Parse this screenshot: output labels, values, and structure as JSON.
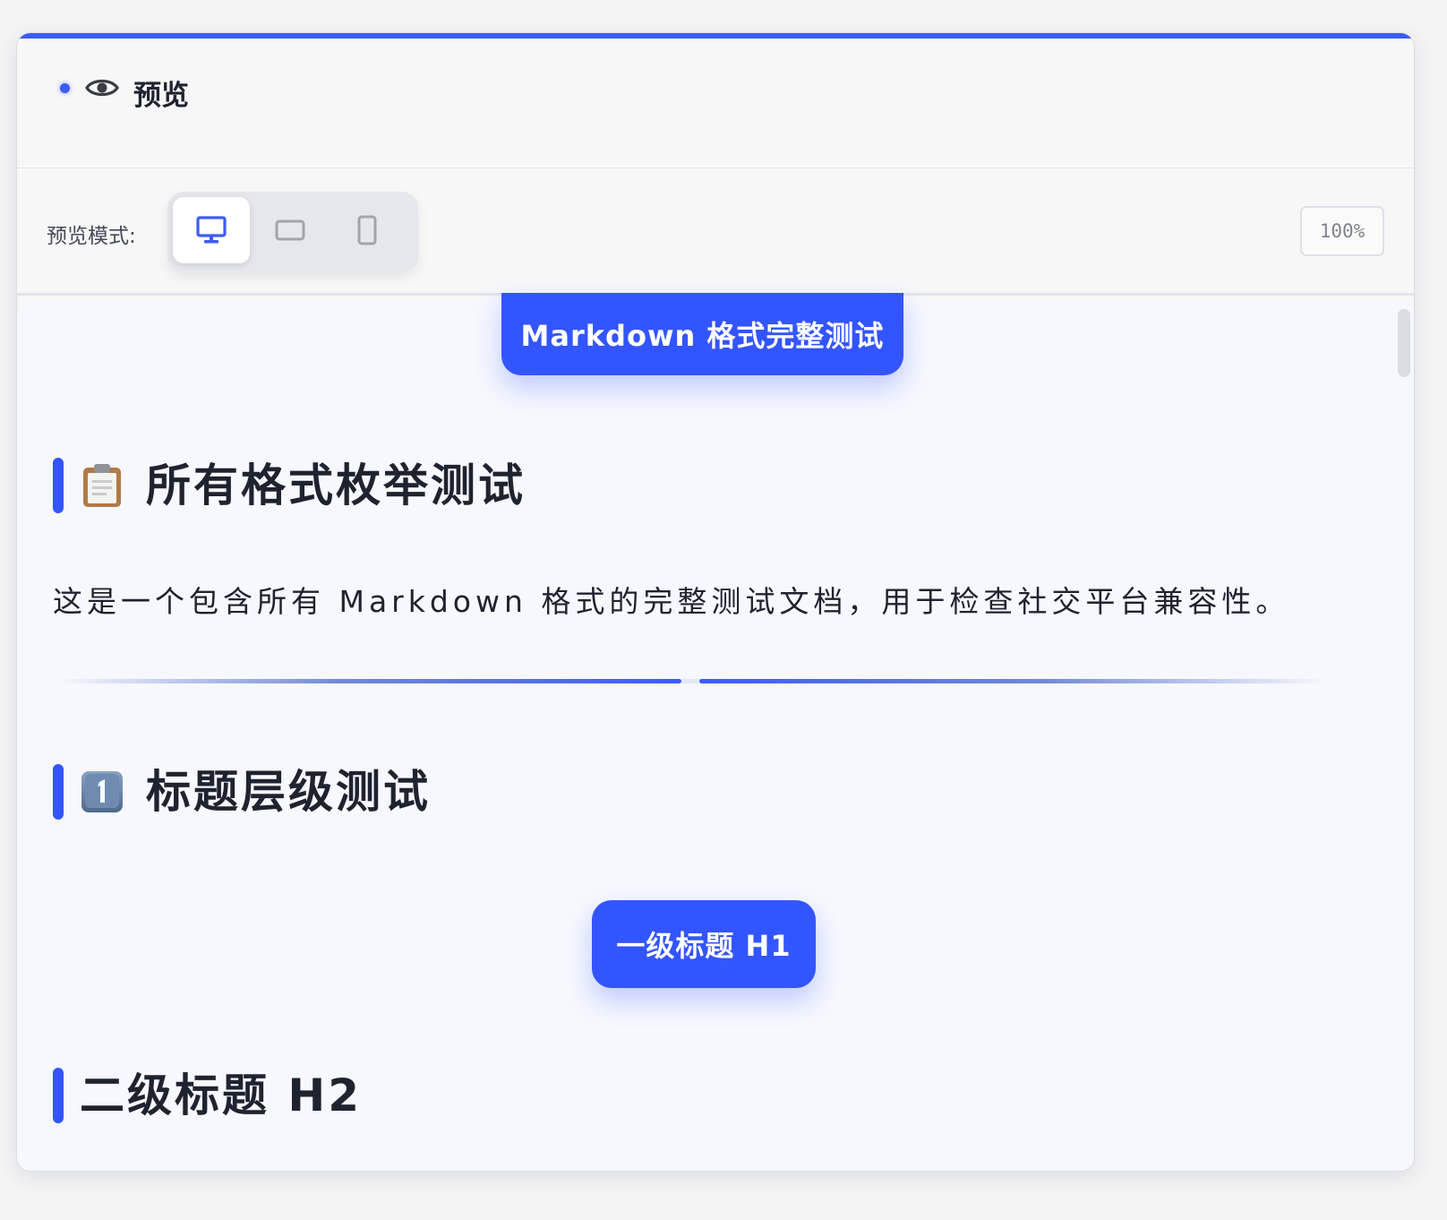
{
  "header": {
    "title": "预览",
    "status_icon": "status-dot",
    "icon": "eye-icon"
  },
  "toolbar": {
    "mode_label": "预览模式:",
    "modes": [
      {
        "icon": "desktop-icon",
        "active": true
      },
      {
        "icon": "tablet-icon",
        "active": false
      },
      {
        "icon": "mobile-icon",
        "active": false
      }
    ],
    "zoom": "100%"
  },
  "content": {
    "doc_title": "Markdown 格式完整测试",
    "section1": {
      "icon": "clipboard-icon",
      "title": "所有格式枚举测试"
    },
    "intro": "这是一个包含所有 Markdown 格式的完整测试文档，用于检查社交平台兼容性。",
    "section2": {
      "icon": "keycap-one-icon",
      "title": "标题层级测试"
    },
    "h1_sample": "一级标题 H1",
    "h2_sample": "二级标题 H2"
  },
  "colors": {
    "accent": "#3355ff",
    "panel_bg": "#f7f7f8",
    "content_bg": "#f6f8fd"
  }
}
